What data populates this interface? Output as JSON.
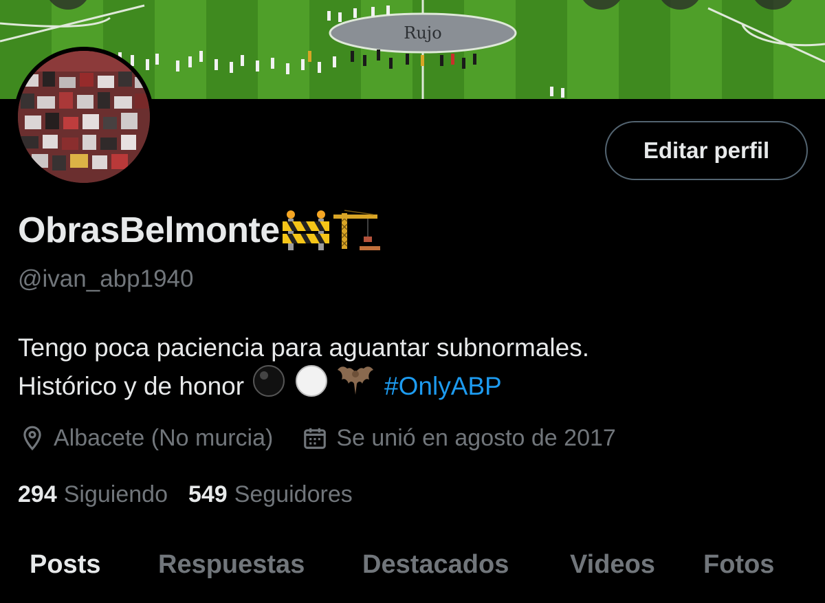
{
  "profile": {
    "display_name": "ObrasBelmonte",
    "handle": "@ivan_abp1940",
    "edit_button": "Editar perfil",
    "bio_line1": "Tengo poca paciencia para aguantar subnormales.",
    "bio_line2": "Histórico y de honor",
    "hashtag": "#OnlyABP",
    "location": "Albacete (No murcia)",
    "joined": "Se unió en agosto de 2017",
    "following_count": "294",
    "following_label": "Siguiendo",
    "followers_count": "549",
    "followers_label": "Seguidores",
    "name_emojis": [
      "construction-barrier-icon",
      "crane-icon"
    ],
    "bio_emojis": [
      "black-circle-icon",
      "white-circle-icon",
      "bat-icon"
    ]
  },
  "banner": {
    "pitch_text": "Rujo"
  },
  "tabs": [
    {
      "label": "Posts",
      "active": true
    },
    {
      "label": "Respuestas",
      "active": false
    },
    {
      "label": "Destacados",
      "active": false
    },
    {
      "label": "Videos",
      "active": false
    },
    {
      "label": "Fotos",
      "active": false
    }
  ],
  "colors": {
    "background": "#000000",
    "text_primary": "#e7e9ea",
    "text_secondary": "#71767b",
    "link": "#1d9bf0",
    "button_border": "#536471"
  }
}
